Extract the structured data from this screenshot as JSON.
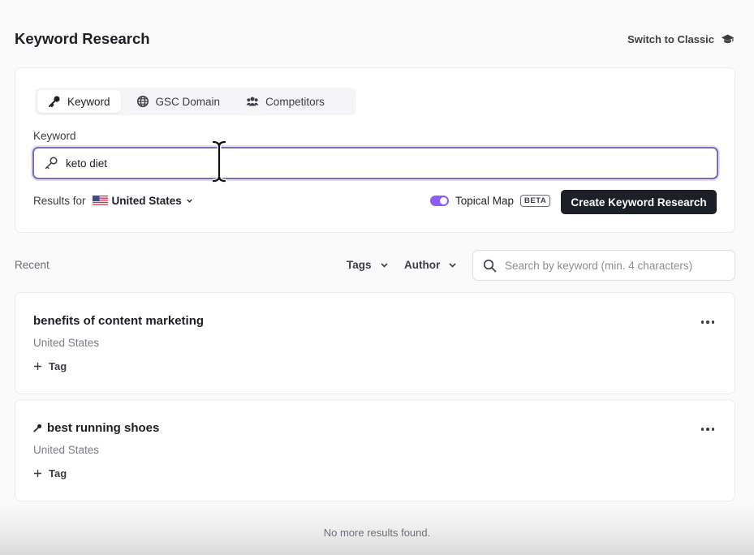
{
  "header": {
    "title": "Keyword Research",
    "switch_label": "Switch to Classic",
    "switch_icon": "graduation-cap-icon"
  },
  "form": {
    "tabs": [
      {
        "label": "Keyword",
        "icon": "key-icon",
        "active": true
      },
      {
        "label": "GSC Domain",
        "icon": "globe-icon",
        "active": false
      },
      {
        "label": "Competitors",
        "icon": "users-icon",
        "active": false
      }
    ],
    "field_label": "Keyword",
    "keyword_value": "keto diet",
    "results_for_label": "Results for",
    "country": "United States",
    "topical_map_label": "Topical Map",
    "topical_map_enabled": true,
    "beta_label": "BETA",
    "create_label": "Create Keyword Research"
  },
  "recent": {
    "label": "Recent",
    "tags_filter": "Tags",
    "author_filter": "Author",
    "search_placeholder": "Search by keyword (min. 4 characters)",
    "items": [
      {
        "title": "benefits of content marketing",
        "country": "United States",
        "tag_label": "Tag",
        "has_key_icon": false
      },
      {
        "title": "best running shoes",
        "country": "United States",
        "tag_label": "Tag",
        "has_key_icon": true
      }
    ],
    "empty_message": "No more results found."
  },
  "colors": {
    "accent": "#8b5cf6",
    "primary_button": "#1c1f27",
    "input_focus_border": "#7d6bb3"
  }
}
